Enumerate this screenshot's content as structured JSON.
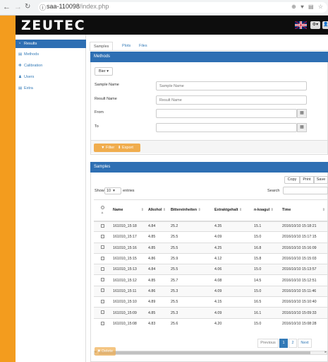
{
  "browser": {
    "url_host": "saa-110098",
    "url_path": "/index.php"
  },
  "header": {
    "logo": "ZEUTEC"
  },
  "sidebar": {
    "items": [
      {
        "label": "Results",
        "icon": "gauge-icon"
      },
      {
        "label": "Methods",
        "icon": "list-icon"
      },
      {
        "label": "Calibration",
        "icon": "gear-icon"
      },
      {
        "label": "Users",
        "icon": "user-icon"
      },
      {
        "label": "Extra",
        "icon": "list-icon"
      }
    ]
  },
  "tabs": [
    "Samples",
    "Plots",
    "Files"
  ],
  "methods_panel": {
    "title": "Methods",
    "dropdown": "Bier",
    "fields": [
      {
        "label": "Sample Name",
        "placeholder": "Sample Name"
      },
      {
        "label": "Result Name",
        "placeholder": "Result Name"
      },
      {
        "label": "From",
        "placeholder": ""
      },
      {
        "label": "To",
        "placeholder": ""
      }
    ],
    "filter_label": "Filter",
    "export_label": "Export"
  },
  "samples_panel": {
    "title": "Samples",
    "copy_label": "Copy",
    "print_label": "Print",
    "save_label": "Save",
    "show_label": "Show",
    "show_value": "10",
    "entries_label": "entries",
    "search_label": "Search",
    "columns": [
      "Name",
      "Alkohol",
      "Bittereinheiten",
      "Extraktgehalt",
      "n-koagul",
      "Time"
    ],
    "rows": [
      [
        "161010_15:18",
        "4.84",
        "25.2",
        "4.35",
        "15.1",
        "2016/10/10 15:18:21"
      ],
      [
        "161010_15:17",
        "4.85",
        "25.5",
        "4.09",
        "15.0",
        "2016/10/10 15:17:15"
      ],
      [
        "161010_15:16",
        "4.85",
        "25.5",
        "4.25",
        "16.8",
        "2016/10/10 15:16:09"
      ],
      [
        "161010_15:15",
        "4.86",
        "25.9",
        "4.12",
        "15.8",
        "2016/10/10 15:15:03"
      ],
      [
        "161010_15:13",
        "4.84",
        "25.5",
        "4.06",
        "15.0",
        "2016/10/10 15:13:57"
      ],
      [
        "161010_15:12",
        "4.85",
        "25.7",
        "4.08",
        "14.5",
        "2016/10/10 15:12:51"
      ],
      [
        "161010_15:11",
        "4.86",
        "25.3",
        "4.09",
        "15.0",
        "2016/10/10 15:11:46"
      ],
      [
        "161010_15:10",
        "4.89",
        "25.5",
        "4.15",
        "16.5",
        "2016/10/10 15:10:40"
      ],
      [
        "161010_15:09",
        "4.85",
        "25.3",
        "4.09",
        "16.1",
        "2016/10/10 15:09:33"
      ],
      [
        "161010_15:08",
        "4.83",
        "25.6",
        "4.20",
        "15.0",
        "2016/10/10 15:08:28"
      ]
    ],
    "pagination": {
      "previous": "Previous",
      "page1": "1",
      "page2": "2",
      "next": "Next"
    },
    "delete_label": "Delete"
  },
  "colors": {
    "accent": "#2e6fb3",
    "orange": "#f0ad4e",
    "background": "#f39c1e"
  }
}
